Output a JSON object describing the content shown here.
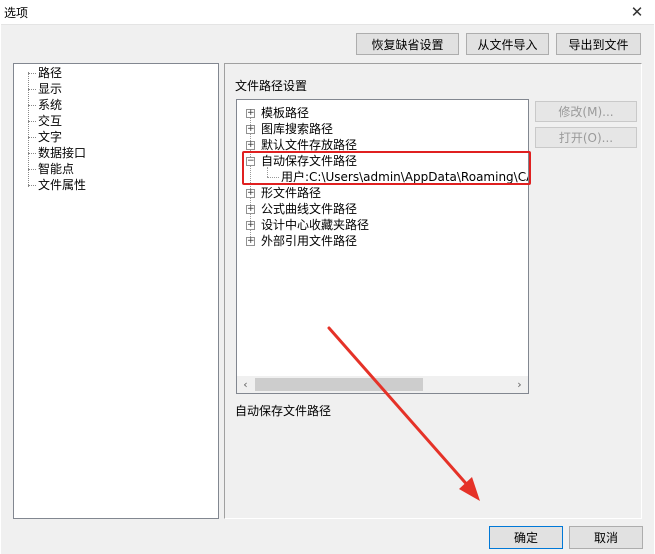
{
  "window": {
    "title": "选项",
    "close_glyph": "✕"
  },
  "top_buttons": {
    "restore_defaults": "恢复缺省设置",
    "import_from_file": "从文件导入",
    "export_to_file": "导出到文件"
  },
  "nav": {
    "items": [
      {
        "label": "路径"
      },
      {
        "label": "显示"
      },
      {
        "label": "系统"
      },
      {
        "label": "交互"
      },
      {
        "label": "文字"
      },
      {
        "label": "数据接口"
      },
      {
        "label": "智能点"
      },
      {
        "label": "文件属性"
      }
    ]
  },
  "content": {
    "section_title": "文件路径设置",
    "tree": [
      {
        "label": "模板路径",
        "state": "collapsed"
      },
      {
        "label": "图库搜索路径",
        "state": "collapsed"
      },
      {
        "label": "默认文件存放路径",
        "state": "collapsed"
      },
      {
        "label": "自动保存文件路径",
        "state": "expanded"
      },
      {
        "label": "用户:C:\\Users\\admin\\AppData\\Roaming\\CAXA\\CAXA",
        "state": "child"
      },
      {
        "label": "形文件路径",
        "state": "collapsed"
      },
      {
        "label": "公式曲线文件路径",
        "state": "collapsed"
      },
      {
        "label": "设计中心收藏夹路径",
        "state": "collapsed"
      },
      {
        "label": "外部引用文件路径",
        "state": "collapsed"
      }
    ],
    "modify_button": "修改(M)...",
    "open_button": "打开(O)...",
    "description": "自动保存文件路径",
    "highlight_color": "#e02020"
  },
  "bottom_buttons": {
    "ok": "确定",
    "cancel": "取消"
  },
  "annotation": {
    "arrow_color": "#e53228"
  }
}
